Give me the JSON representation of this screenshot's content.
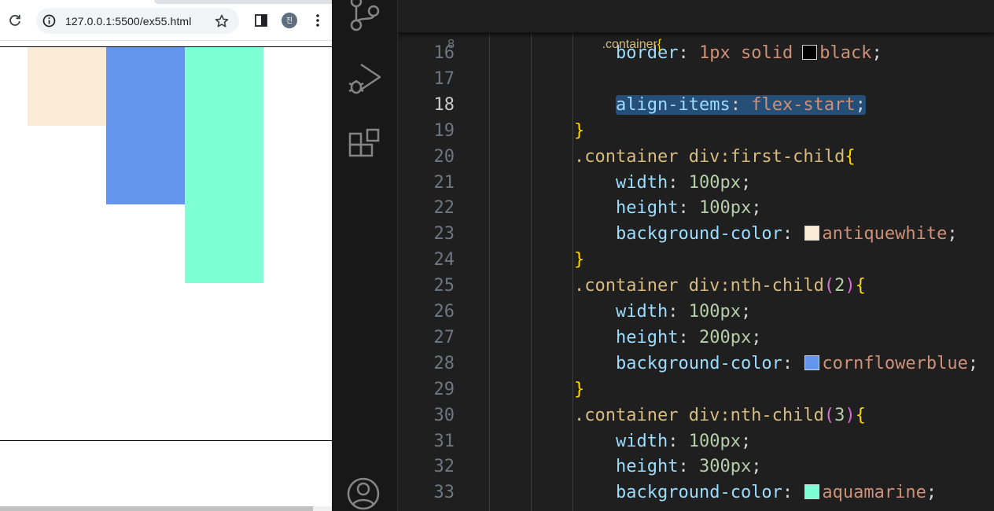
{
  "browser": {
    "url": "127.0.0.1:5500/ex55.html",
    "avatar_initial": "진",
    "boxes": [
      {
        "color": "antiquewhite"
      },
      {
        "color": "cornflowerblue"
      },
      {
        "color": "aquamarine"
      }
    ]
  },
  "activity_bar": {
    "icons": [
      "source-control-icon",
      "run-debug-icon",
      "extensions-icon",
      "account-icon"
    ]
  },
  "editor": {
    "sticky": {
      "line": "8",
      "selector": ".container",
      "brace": "{"
    },
    "lines": [
      {
        "n": "16",
        "prop": "border",
        "val": "1px solid",
        "swatch": "#000000",
        "color_word": "black"
      },
      {
        "n": "17"
      },
      {
        "n": "18",
        "prop": "align-items",
        "val": "flex-start"
      },
      {
        "n": "19",
        "brace": "}"
      },
      {
        "n": "20",
        "selector": ".container div:first-child",
        "brace": "{"
      },
      {
        "n": "21",
        "prop": "width",
        "num": "100px"
      },
      {
        "n": "22",
        "prop": "height",
        "num": "100px"
      },
      {
        "n": "23",
        "prop": "background-color",
        "swatch": "#faebd7",
        "color_word": "antiquewhite"
      },
      {
        "n": "24",
        "brace": "}"
      },
      {
        "n": "25",
        "selector": ".container div:nth-child",
        "arg": "2",
        "brace": "{"
      },
      {
        "n": "26",
        "prop": "width",
        "num": "100px"
      },
      {
        "n": "27",
        "prop": "height",
        "num": "200px"
      },
      {
        "n": "28",
        "prop": "background-color",
        "swatch": "#6495ed",
        "color_word": "cornflowerblue"
      },
      {
        "n": "29",
        "brace": "}"
      },
      {
        "n": "30",
        "selector": ".container div:nth-child",
        "arg": "3",
        "brace": "{"
      },
      {
        "n": "31",
        "prop": "width",
        "num": "100px"
      },
      {
        "n": "32",
        "prop": "height",
        "num": "300px"
      },
      {
        "n": "33",
        "prop": "background-color",
        "swatch": "#7fffd4",
        "color_word": "aquamarine"
      }
    ],
    "active_line": "18"
  }
}
